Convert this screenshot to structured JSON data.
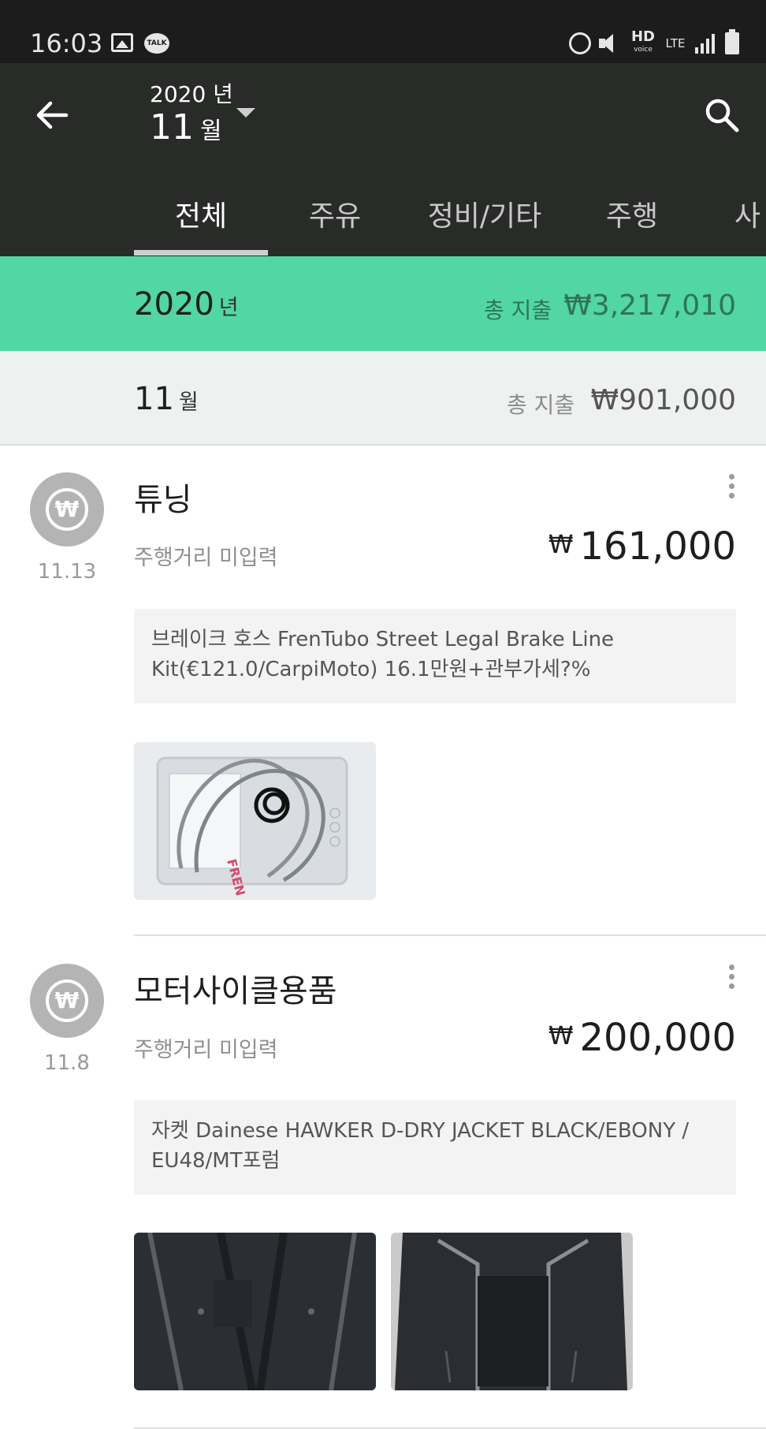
{
  "status_bar": {
    "time": "16:03",
    "left_icons": [
      "gallery-icon",
      "talk-icon"
    ],
    "talk_badge": "TALK",
    "right_icons": [
      "alarm-icon",
      "mute-icon",
      "hd-voice-icon",
      "lte-icon",
      "signal-icon",
      "battery-icon"
    ],
    "hd": "HD",
    "voice": "voice",
    "lte": "LTE"
  },
  "header": {
    "year": "2020 년",
    "month_number": "11",
    "month_unit": "월"
  },
  "tabs": [
    {
      "label": "전체",
      "active": true
    },
    {
      "label": "주유",
      "active": false
    },
    {
      "label": "정비/기타",
      "active": false
    },
    {
      "label": "주행",
      "active": false
    },
    {
      "label": "사",
      "active": false
    }
  ],
  "year_summary": {
    "number": "2020",
    "unit": "년",
    "label": "총 지출",
    "amount": "₩3,217,010"
  },
  "month_summary": {
    "number": "11",
    "unit": "월",
    "label": "총 지출",
    "amount": "₩901,000"
  },
  "entries": [
    {
      "date": "11.13",
      "category": "튜닝",
      "odometer": "주행거리 미입력",
      "currency": "₩",
      "amount": "161,000",
      "memo_line1": "브레이크 호스 FrenTubo Street Legal Brake Line",
      "memo_line2": "Kit(€121.0/CarpiMoto) 16.1만원+관부가세?%",
      "photos": [
        "brake-line-kit-photo"
      ]
    },
    {
      "date": "11.8",
      "category": "모터사이클용품",
      "odometer": "주행거리 미입력",
      "currency": "₩",
      "amount": "200,000",
      "memo_line1": "자켓 Dainese HAWKER D-DRY JACKET BLACK/EBONY /",
      "memo_line2": "EU48/MT포럼",
      "photos": [
        "jacket-front-photo",
        "jacket-back-photo"
      ]
    }
  ],
  "colors": {
    "status_bar": "#1b1c1b",
    "app_bar": "#292b29",
    "year_summary_bg": "#52d6a2",
    "month_summary_bg": "#eef1ef",
    "category_icon": "#b4b4b4"
  },
  "category_icon_symbol": "₩"
}
